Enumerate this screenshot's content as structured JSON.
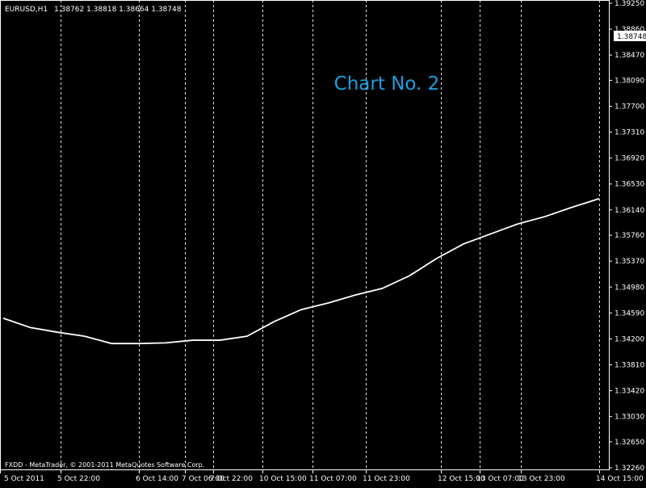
{
  "header": {
    "symbol": "EURUSD,H1",
    "ohlc": "1.38762 1.38818 1.38664 1.38748"
  },
  "overlay_label": "Chart No. 2",
  "footer_credit": "FXDD - MetaTrader, © 2001-2011 MetaQuotes Software Corp.",
  "chart_data": {
    "type": "line",
    "title": "",
    "xlabel": "",
    "ylabel": "",
    "ylim": [
      1.3226,
      1.3925
    ],
    "grid": "vertical-dashed",
    "current_price": "1.38748",
    "x_ticks": [
      "5 Oct 2011",
      "5 Oct 22:00",
      "6 Oct 14:00",
      "7 Oct 06:00",
      "7 Oct 22:00",
      "10 Oct 15:00",
      "11 Oct 07:00",
      "11 Oct 23:00",
      "12 Oct 15:00",
      "13 Oct 07:00",
      "13 Oct 23:00",
      "14 Oct 15:00"
    ],
    "y_ticks": [
      "1.39250",
      "1.38860",
      "1.38470",
      "1.38090",
      "1.37700",
      "1.37310",
      "1.36920",
      "1.36530",
      "1.36140",
      "1.35760",
      "1.35370",
      "1.34980",
      "1.34590",
      "1.34200",
      "1.33810",
      "1.33420",
      "1.33030",
      "1.32650",
      "1.32260"
    ],
    "series": [
      {
        "values": [
          1.3451,
          1.3437,
          1.343,
          1.3424,
          1.3413,
          1.3413,
          1.3414,
          1.3418,
          1.3418,
          1.3424,
          1.3446,
          1.3464,
          1.3474,
          1.3486,
          1.3496,
          1.3515,
          1.3541,
          1.3563,
          1.3578,
          1.3593,
          1.3604,
          1.3618,
          1.3631
        ]
      }
    ],
    "colors": {
      "background": "#000000",
      "line": "#ffffff",
      "grid": "#ffffff",
      "text": "#ffffff",
      "overlay": "#1e9fe0"
    }
  }
}
